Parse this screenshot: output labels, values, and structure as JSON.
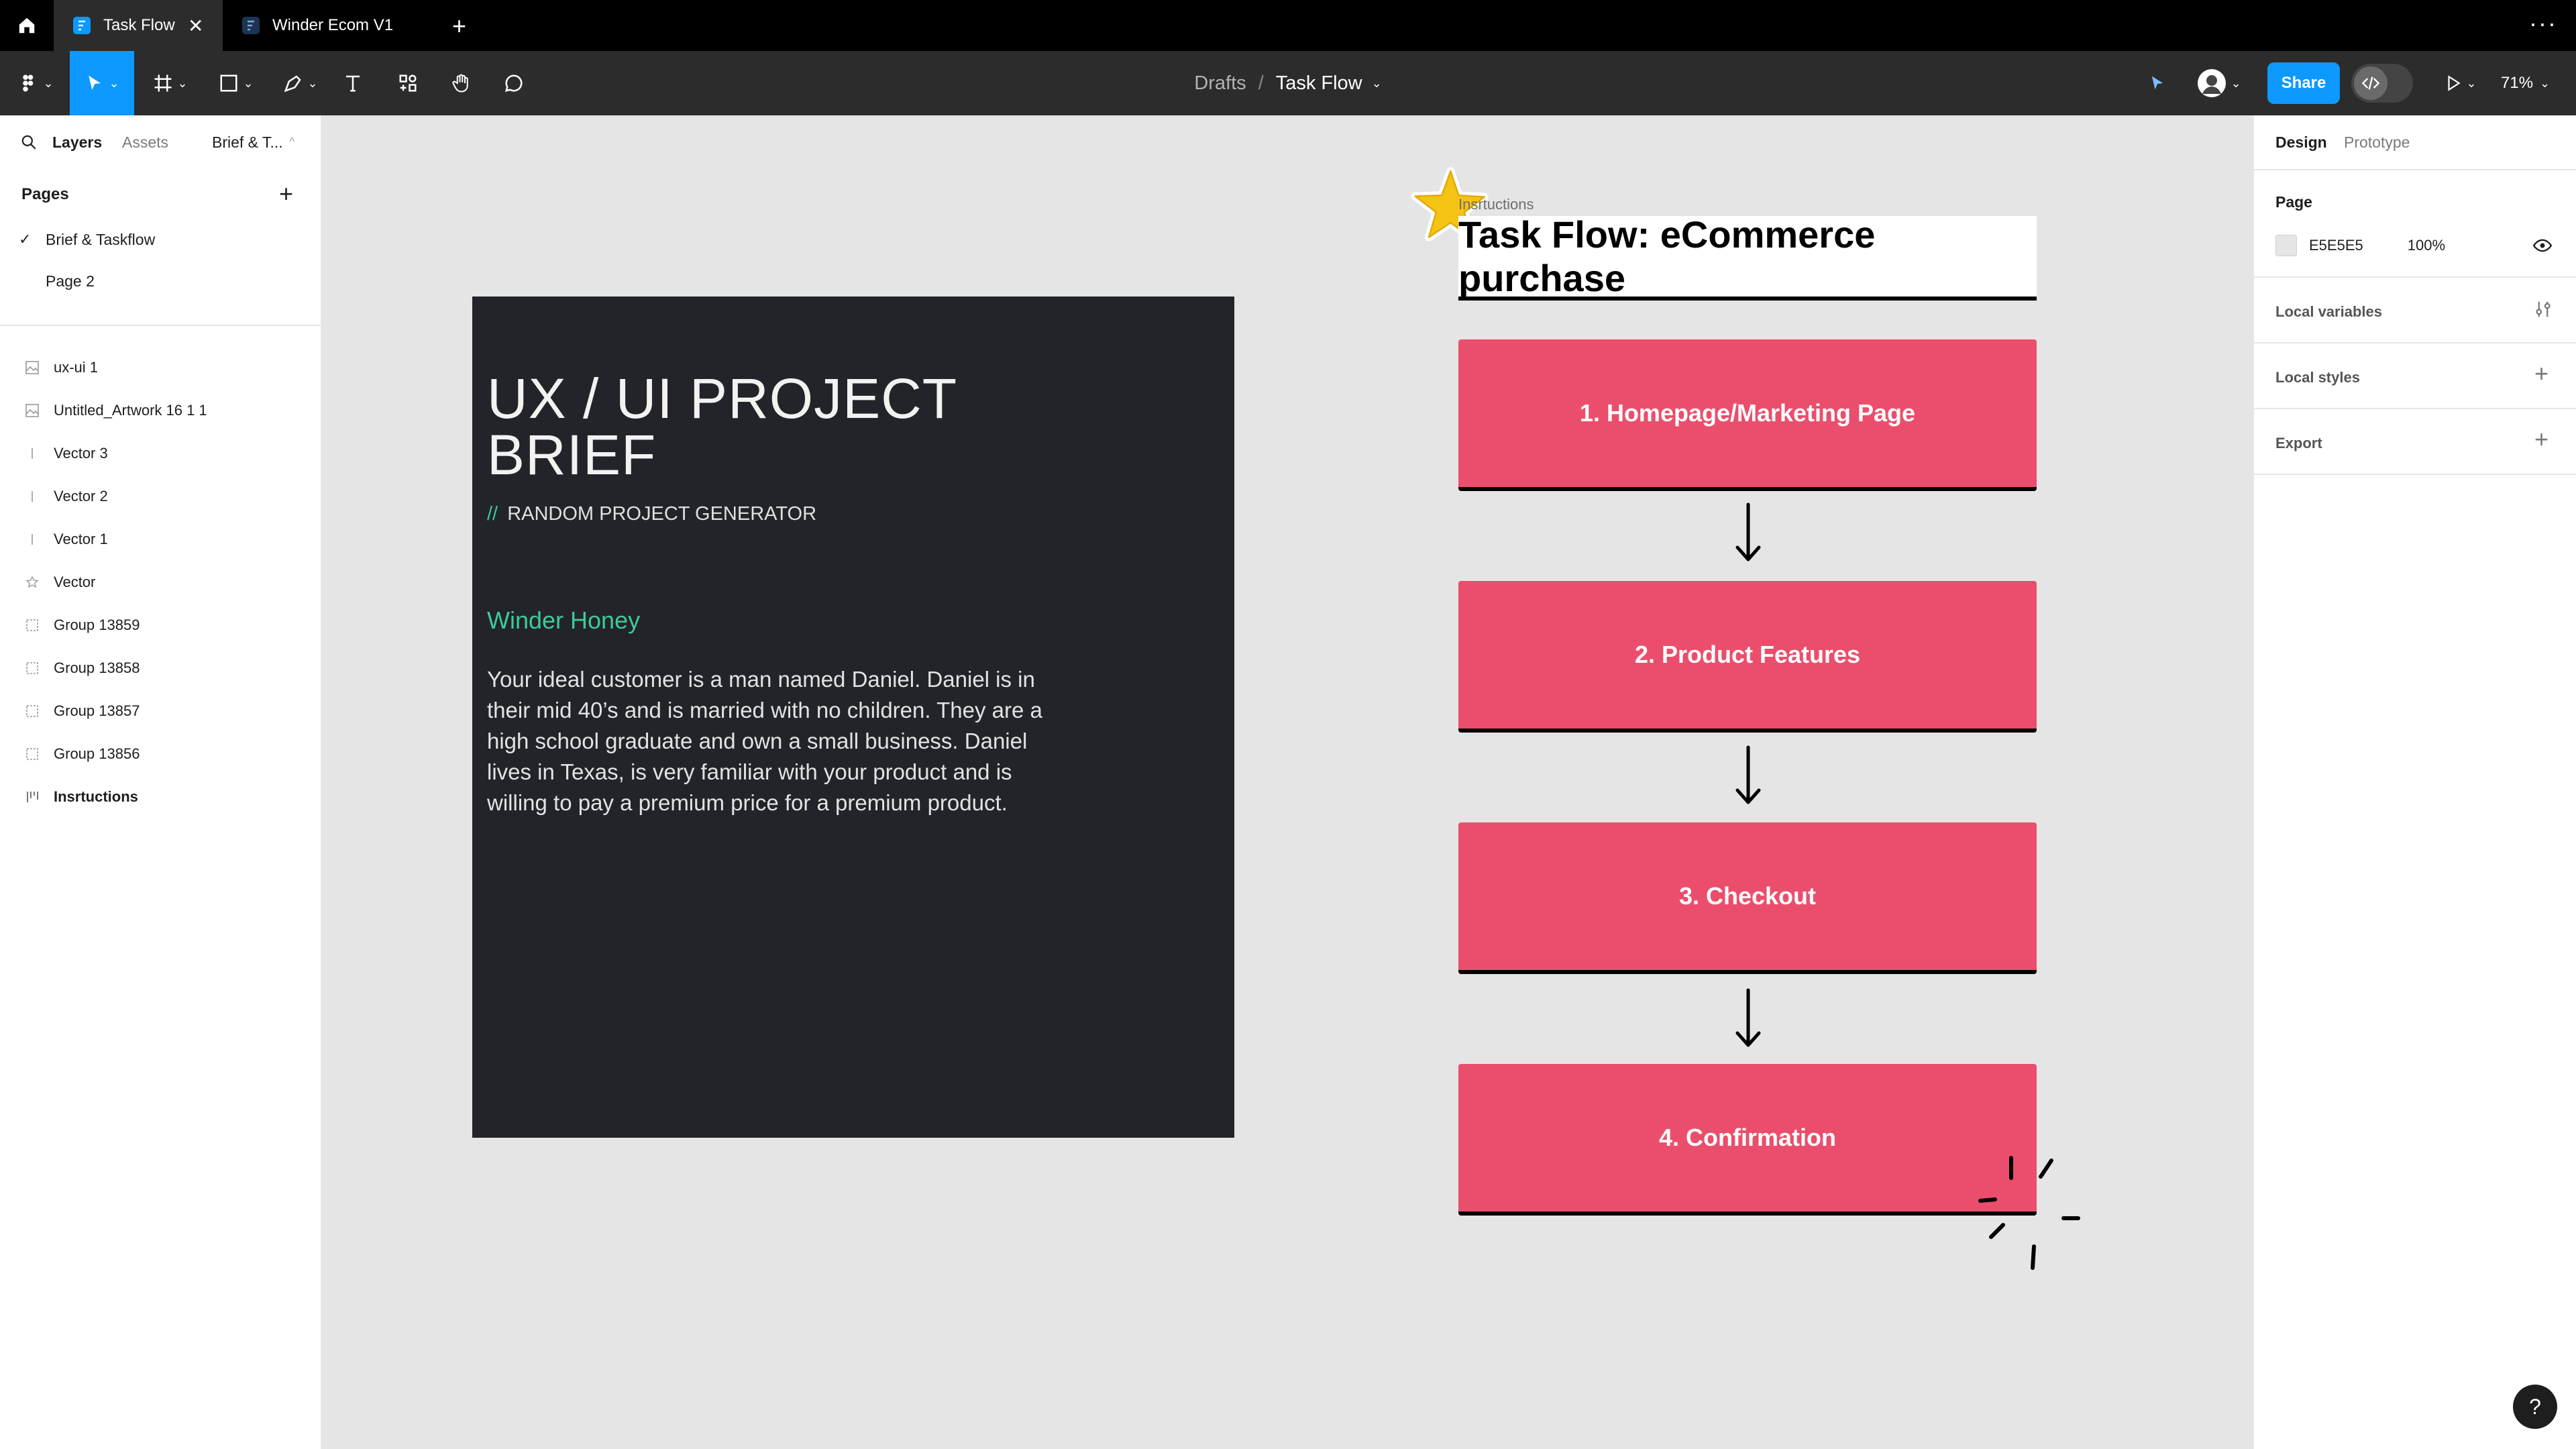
{
  "tabs": [
    {
      "label": "Task Flow",
      "active": true
    },
    {
      "label": "Winder Ecom V1",
      "active": false
    }
  ],
  "toolbar": {
    "breadcrumb": {
      "drafts": "Drafts",
      "sep": "/",
      "file": "Task Flow"
    },
    "share_label": "Share",
    "zoom": "71%"
  },
  "left_panel": {
    "tabs": {
      "layers": "Layers",
      "assets": "Assets",
      "page": "Brief & T..."
    },
    "pages_title": "Pages",
    "pages": [
      {
        "label": "Brief & Taskflow",
        "selected": true
      },
      {
        "label": "Page 2",
        "selected": false
      }
    ],
    "layers": [
      {
        "label": "ux-ui 1",
        "icon": "image-icon"
      },
      {
        "label": "Untitled_Artwork 16 1 1",
        "icon": "image-icon"
      },
      {
        "label": "Vector 3",
        "icon": "line-icon"
      },
      {
        "label": "Vector 2",
        "icon": "line-icon"
      },
      {
        "label": "Vector 1",
        "icon": "line-icon"
      },
      {
        "label": "Vector",
        "icon": "star-vector-icon"
      },
      {
        "label": "Group 13859",
        "icon": "group-icon"
      },
      {
        "label": "Group 13858",
        "icon": "group-icon"
      },
      {
        "label": "Group 13857",
        "icon": "group-icon"
      },
      {
        "label": "Group 13856",
        "icon": "group-icon"
      },
      {
        "label": "Insrtuctions",
        "icon": "section-icon",
        "bold": true
      }
    ]
  },
  "right_panel": {
    "tabs": {
      "design": "Design",
      "prototype": "Prototype"
    },
    "page_title": "Page",
    "page_color": "E5E5E5",
    "page_opacity": "100%",
    "local_variables": "Local variables",
    "local_styles": "Local styles",
    "export": "Export"
  },
  "canvas": {
    "brief": {
      "title": "UX / UI PROJECT BRIEF",
      "sub_prefix": "//",
      "subtitle": "RANDOM PROJECT GENERATOR",
      "name": "Winder Honey",
      "body": "Your ideal customer is a man named Daniel. Daniel is in their mid 40’s and is married with no children. They are a high school graduate and own a small business. Daniel lives in Texas, is very familiar with your product and is willing to pay a premium price for a premium product."
    },
    "instructions_label": "Insrtuctions",
    "flow_title": "Task Flow: eCommerce purchase",
    "steps": [
      "1. Homepage/Marketing Page",
      "2. Product Features",
      "3. Checkout",
      "4. Confirmation"
    ]
  },
  "colors": {
    "accent_blue": "#0d99ff",
    "step_fill": "#eb4e6c",
    "brief_bg": "#222429",
    "brief_accent": "#3ec99a",
    "canvas_bg": "#e5e5e5"
  }
}
